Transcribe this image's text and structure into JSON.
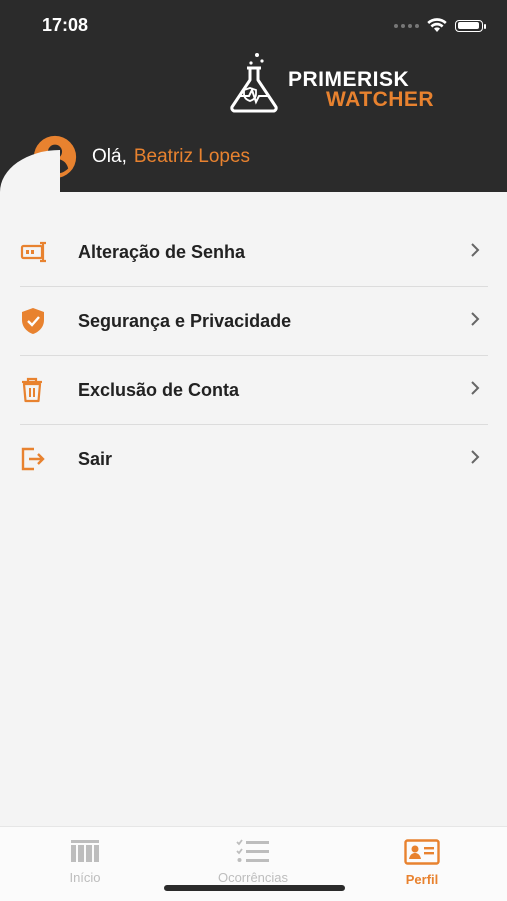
{
  "status_bar": {
    "time": "17:08"
  },
  "logo": {
    "line1_prime": "PRIME",
    "line1_risk": "RISK",
    "line2": "WATCHER"
  },
  "greeting": {
    "prefix": "Olá,",
    "name": "Beatriz Lopes"
  },
  "menu": {
    "items": [
      {
        "label": "Alteração de Senha",
        "icon": "password-icon"
      },
      {
        "label": "Segurança e Privacidade",
        "icon": "shield-check-icon"
      },
      {
        "label": "Exclusão de Conta",
        "icon": "trash-icon"
      },
      {
        "label": "Sair",
        "icon": "logout-icon"
      }
    ]
  },
  "tabbar": {
    "tabs": [
      {
        "label": "Início",
        "icon": "home-icon",
        "active": false
      },
      {
        "label": "Ocorrências",
        "icon": "checklist-icon",
        "active": false
      },
      {
        "label": "Perfil",
        "icon": "profile-card-icon",
        "active": true
      }
    ]
  },
  "colors": {
    "accent": "#e8822f",
    "header_bg": "#2b2b2b",
    "page_bg": "#f4f4f4"
  }
}
